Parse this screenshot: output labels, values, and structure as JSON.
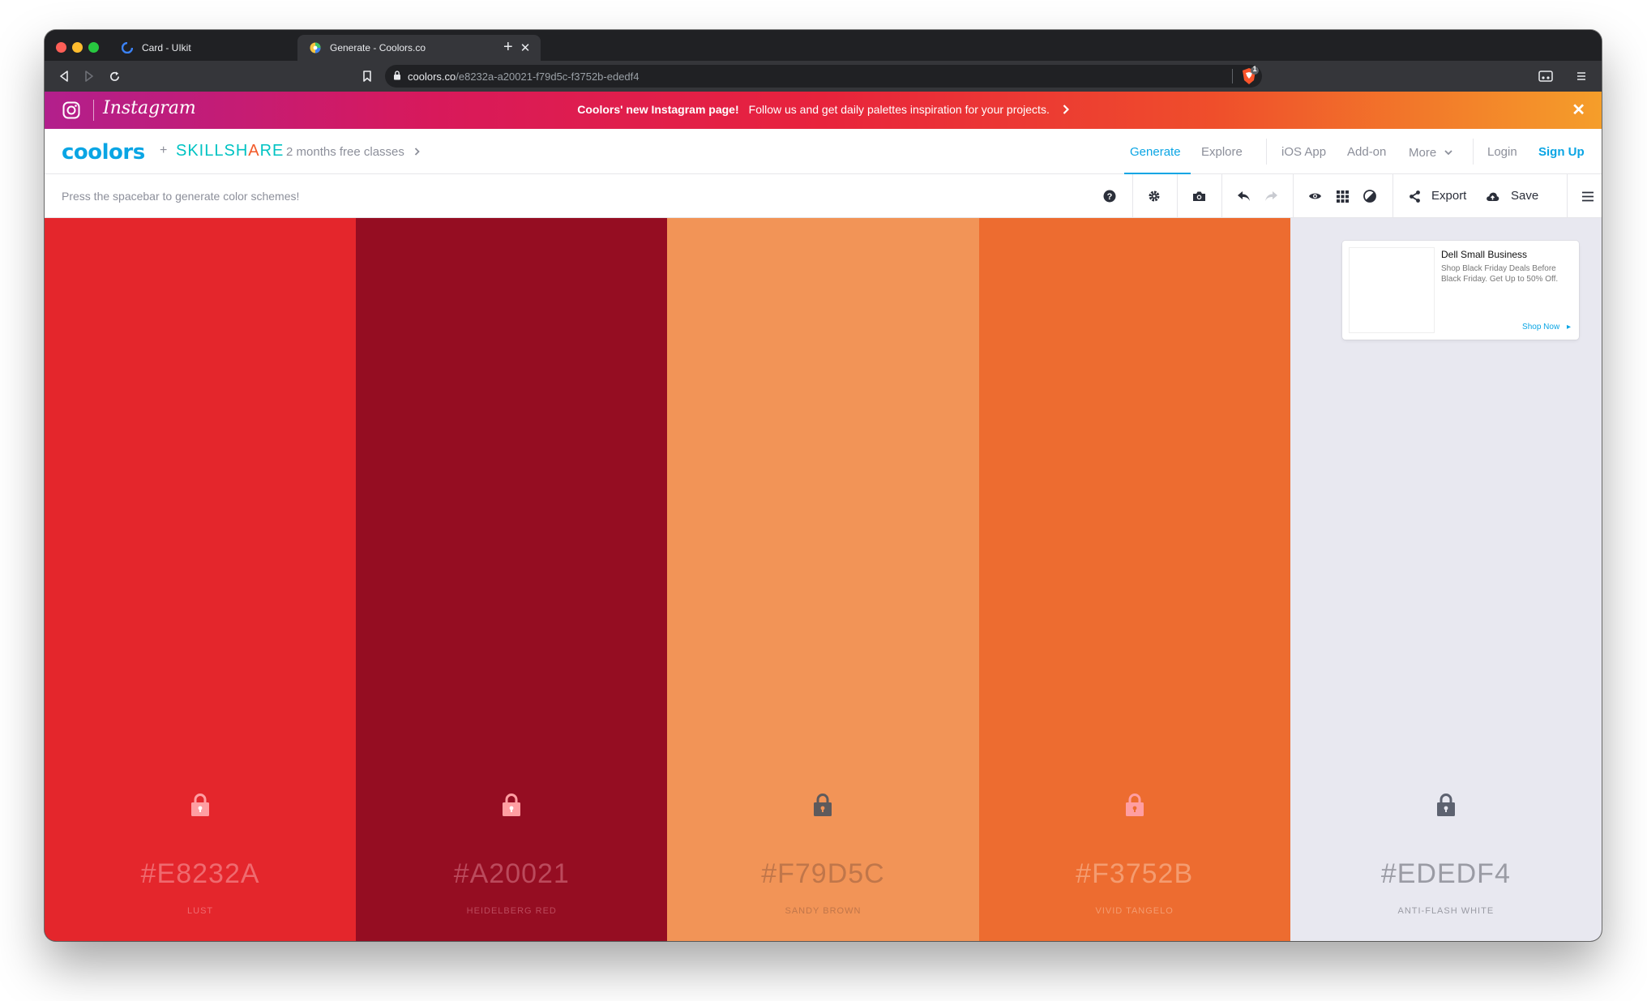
{
  "browser": {
    "tabs": [
      {
        "title": "Card - UIkit",
        "active": false
      },
      {
        "title": "Generate - Coolors.co",
        "active": true
      }
    ],
    "url_host": "coolors.co",
    "url_path": "/e8232a-a20021-f79d5c-f3752b-ededf4",
    "brave_badge": "1"
  },
  "banner": {
    "brand": "Instagram",
    "headline": "Coolors' new Instagram page!",
    "text": "Follow us and get daily palettes inspiration for your projects."
  },
  "nav": {
    "logo": "coolors",
    "plus": "+",
    "partner_part1": "SKILLSH",
    "partner_part2": "A",
    "partner_part3": "RE",
    "promo": "2 months free classes",
    "links": [
      "Generate",
      "Explore",
      "iOS App",
      "Add-on",
      "More",
      "Login",
      "Sign Up"
    ]
  },
  "toolbar": {
    "hint": "Press the spacebar to generate color schemes!",
    "export_label": "Export",
    "save_label": "Save"
  },
  "palette": [
    {
      "hex": "#E8232A",
      "name": "LUST",
      "color": "#e4262c",
      "text_color": "#ef6a6f",
      "locked": false
    },
    {
      "hex": "#A20021",
      "name": "HEIDELBERG RED",
      "color": "#950d22",
      "text_color": "#bb4a5c",
      "locked": false
    },
    {
      "hex": "#F79D5C",
      "name": "SANDY BROWN",
      "color": "#f29457",
      "text_color": "#c0764a",
      "locked": false
    },
    {
      "hex": "#F3752B",
      "name": "VIVID TANGELO",
      "color": "#ed6c30",
      "text_color": "#f49c70",
      "locked": false
    },
    {
      "hex": "#EDEDF4",
      "name": "ANTI-FLASH WHITE",
      "color": "#e8e8f0",
      "text_color": "#9a9ba4",
      "locked": false
    }
  ],
  "ad": {
    "title": "Dell Small Business",
    "body": "Shop Black Friday Deals Before Black Friday. Get Up to 50% Off.",
    "cta": "Shop Now"
  },
  "icons": {
    "help": "question-circle-icon",
    "settings": "gear-icon",
    "camera": "camera-icon",
    "undo": "undo-icon",
    "redo": "redo-icon",
    "view": "eye-icon",
    "grid": "grid-icon",
    "contrast": "contrast-icon",
    "share": "share-icon",
    "cloud": "cloud-upload-icon",
    "menu": "hamburger-icon"
  }
}
